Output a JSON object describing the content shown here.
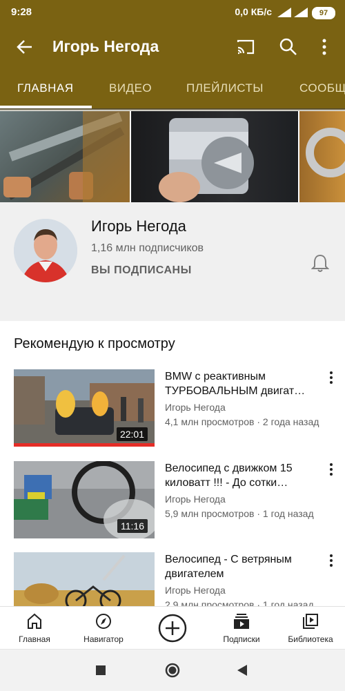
{
  "status_bar": {
    "time": "9:28",
    "network_speed": "0,0 КБ/с",
    "network_type": "4G",
    "battery": "97"
  },
  "app_bar": {
    "title": "Игорь Негода",
    "icons": [
      "back-arrow-icon",
      "cast-icon",
      "search-icon",
      "more-vert-icon"
    ]
  },
  "tabs": [
    {
      "label": "ГЛАВНАЯ",
      "active": true
    },
    {
      "label": "ВИДЕО",
      "active": false
    },
    {
      "label": "ПЛЕЙЛИСТЫ",
      "active": false
    },
    {
      "label": "СООБЩ",
      "active": false
    }
  ],
  "channel": {
    "name": "Игорь Негода",
    "subscribers": "1,16 млн подписчиков",
    "subscribe_status": "ВЫ ПОДПИСАНЫ"
  },
  "section_title": "Рекомендую к просмотру",
  "videos": [
    {
      "title": "BMW с реактивным ТУРБОВАЛЬНЫМ двигат…",
      "channel": "Игорь Негода",
      "meta": "4,1 млн просмотров · 2 года назад",
      "duration": "22:01",
      "watched_fraction": 1.0
    },
    {
      "title": "Велосипед с движком 15 киловатт !!! - До сотки…",
      "channel": "Игорь Негода",
      "meta": "5,9 млн просмотров · 1 год назад",
      "duration": "11:16",
      "watched_fraction": 0
    },
    {
      "title": "Велосипед - С ветряным двигателем",
      "channel": "Игорь Негода",
      "meta": "2,9 млн просмотров · 1 год назад",
      "duration": "",
      "watched_fraction": 0
    }
  ],
  "bottom_nav": [
    {
      "label": "Главная",
      "icon": "home-icon"
    },
    {
      "label": "Навигатор",
      "icon": "explore-compass-icon"
    },
    {
      "label": "",
      "icon": "add-icon"
    },
    {
      "label": "Подписки",
      "icon": "subscriptions-icon"
    },
    {
      "label": "Библиотека",
      "icon": "library-icon"
    }
  ],
  "colors": {
    "app_bar": "#7a6212",
    "progress": "#e52d27"
  }
}
